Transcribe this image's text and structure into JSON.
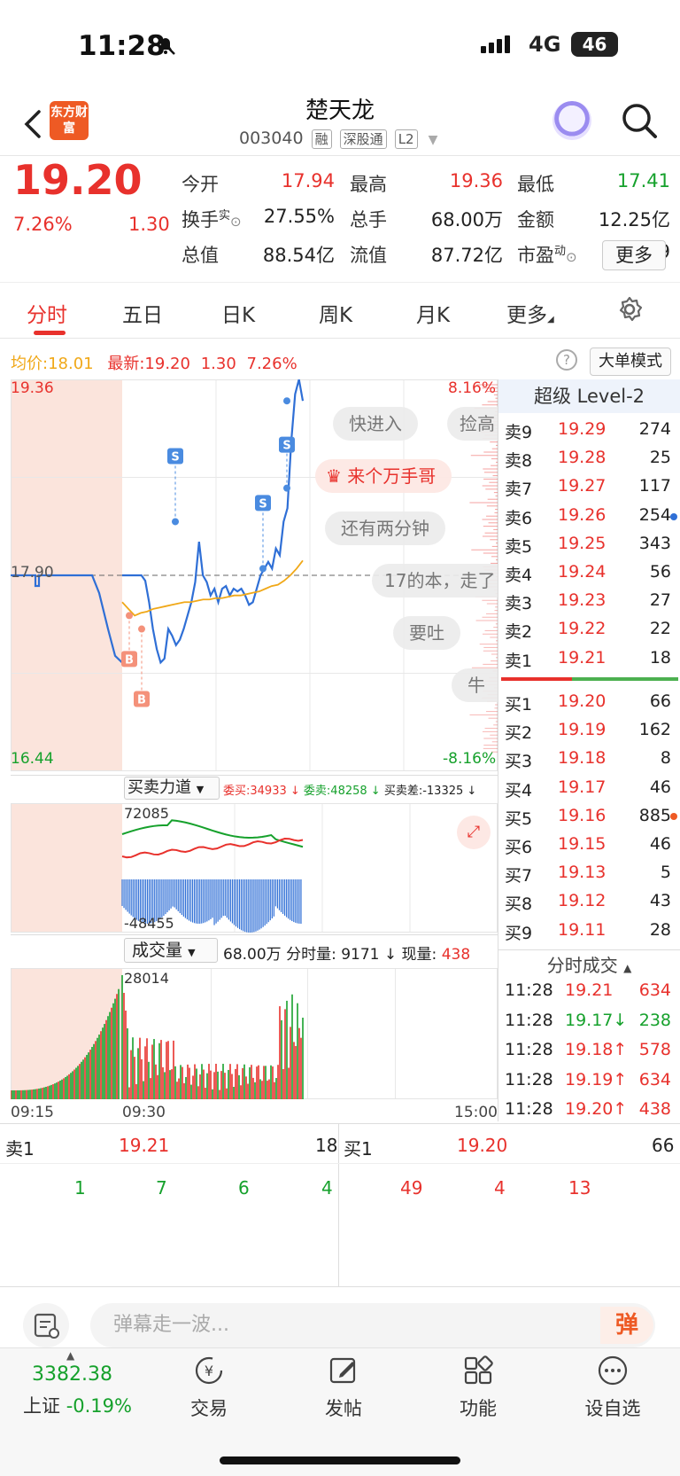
{
  "status_bar": {
    "time": "11:28",
    "network": "4G",
    "battery": "46"
  },
  "header": {
    "logo_text": "东方财富",
    "stock_name": "楚天龙",
    "stock_code": "003040",
    "tags": [
      "融",
      "深股通",
      "L2"
    ]
  },
  "quote": {
    "price": "19.20",
    "pct": "7.26%",
    "chg": "1.30",
    "fields": [
      {
        "label": "今开",
        "value": "17.94",
        "color": "red"
      },
      {
        "label": "最高",
        "value": "19.36",
        "color": "red"
      },
      {
        "label": "最低",
        "value": "17.41",
        "color": "green"
      },
      {
        "label": "换手",
        "sup": "实",
        "value": "27.55%",
        "color": "black"
      },
      {
        "label": "总手",
        "value": "68.00万",
        "color": "black"
      },
      {
        "label": "金额",
        "value": "12.25亿",
        "color": "black"
      },
      {
        "label": "总值",
        "value": "88.54亿",
        "color": "black"
      },
      {
        "label": "流值",
        "value": "87.72亿",
        "color": "black"
      },
      {
        "label": "市盈",
        "sup": "动",
        "value": "120.49",
        "color": "black"
      }
    ],
    "more_label": "更多"
  },
  "tabs": [
    "分时",
    "五日",
    "日K",
    "周K",
    "月K",
    "更多"
  ],
  "avgline": {
    "avg_label": "均价:",
    "avg": "18.01",
    "latest_label": "最新:",
    "latest": "19.20",
    "chg": "1.30",
    "pct": "7.26%",
    "mode_btn": "大单模式"
  },
  "chart_data": {
    "type": "line",
    "yaxis": {
      "max": "19.36",
      "min": "16.44",
      "pct_max": "8.16%",
      "pct_min": "-8.16%",
      "prev_close": "17.90"
    },
    "price": [
      17.9,
      17.9,
      17.9,
      17.9,
      17.9,
      17.9,
      17.86,
      17.7,
      17.5,
      17.35,
      17.25,
      17.28,
      17.5,
      17.45,
      17.38,
      17.42,
      17.5,
      17.6,
      17.7,
      17.85,
      18.15,
      17.9,
      17.85,
      17.75,
      17.8,
      17.7,
      17.8,
      17.82,
      17.75,
      17.8,
      17.78,
      17.8,
      17.75,
      17.68,
      17.7,
      17.8,
      17.9,
      17.95,
      18.0,
      17.95,
      18.1,
      18.05,
      18.3,
      18.4,
      18.9,
      19.25,
      19.36,
      19.2
    ],
    "avg": [
      17.7,
      17.65,
      17.6,
      17.62,
      17.63,
      17.65,
      17.66,
      17.67,
      17.68,
      17.69,
      17.7,
      17.7,
      17.71,
      17.72,
      17.72,
      17.73,
      17.73,
      17.74,
      17.75,
      17.75,
      17.76,
      17.77,
      17.78,
      17.8,
      17.82,
      17.83,
      17.86,
      17.9,
      17.95,
      18.01
    ],
    "times": [
      "09:15",
      "09:30",
      "15:00"
    ],
    "danmaku": [
      "快进入",
      "捡高",
      "来个万手哥",
      "还有两分钟",
      "17的本，走了",
      "要吐",
      "牛"
    ],
    "force": {
      "label": "买卖力道",
      "buy": "委买:34933",
      "sell": "委卖:48258",
      "diff": "买卖差:-13325",
      "ymax": "72085",
      "ymin": "-48455"
    },
    "volume": {
      "label": "成交量",
      "total": "68.00万",
      "minute": "分时量: 9171",
      "now_label": "现量:",
      "now": "438",
      "ymax": "28014"
    }
  },
  "orderbook": {
    "title": "超级 Level-2",
    "asks": [
      [
        "卖9",
        "19.29",
        "274"
      ],
      [
        "卖8",
        "19.28",
        "25"
      ],
      [
        "卖7",
        "19.27",
        "117"
      ],
      [
        "卖6",
        "19.26",
        "254"
      ],
      [
        "卖5",
        "19.25",
        "343"
      ],
      [
        "卖4",
        "19.24",
        "56"
      ],
      [
        "卖3",
        "19.23",
        "27"
      ],
      [
        "卖2",
        "19.22",
        "22"
      ],
      [
        "卖1",
        "19.21",
        "18"
      ]
    ],
    "bids": [
      [
        "买1",
        "19.20",
        "66"
      ],
      [
        "买2",
        "19.19",
        "162"
      ],
      [
        "买3",
        "19.18",
        "8"
      ],
      [
        "买4",
        "19.17",
        "46"
      ],
      [
        "买5",
        "19.16",
        "885"
      ],
      [
        "买6",
        "19.15",
        "46"
      ],
      [
        "买7",
        "19.13",
        "5"
      ],
      [
        "买8",
        "19.12",
        "43"
      ],
      [
        "买9",
        "19.11",
        "28"
      ]
    ]
  },
  "trades": {
    "title": "分时成交",
    "rows": [
      [
        "11:28",
        "19.21",
        "",
        "634"
      ],
      [
        "11:28",
        "19.17",
        "↓",
        "238"
      ],
      [
        "11:28",
        "19.18",
        "↑",
        "578"
      ],
      [
        "11:28",
        "19.19",
        "↑",
        "634"
      ],
      [
        "11:28",
        "19.20",
        "↑",
        "438"
      ]
    ]
  },
  "queue": {
    "sell": {
      "label": "卖1",
      "price": "19.21",
      "vol": "18",
      "orders": [
        "1",
        "7",
        "6",
        "4"
      ]
    },
    "buy": {
      "label": "买1",
      "price": "19.20",
      "vol": "66",
      "orders": [
        "49",
        "4",
        "13"
      ]
    }
  },
  "danmu": {
    "placeholder": "弹幕走一波...",
    "btn": "弹"
  },
  "tabbar": {
    "index_value": "3382.38",
    "index_name": "上证",
    "index_pct": "-0.19%",
    "items": [
      "交易",
      "发帖",
      "功能",
      "设自选"
    ]
  },
  "colors": {
    "up": "#e8312c",
    "down": "#16a12c",
    "line": "#2f6fd6",
    "avg": "#f0a818"
  }
}
